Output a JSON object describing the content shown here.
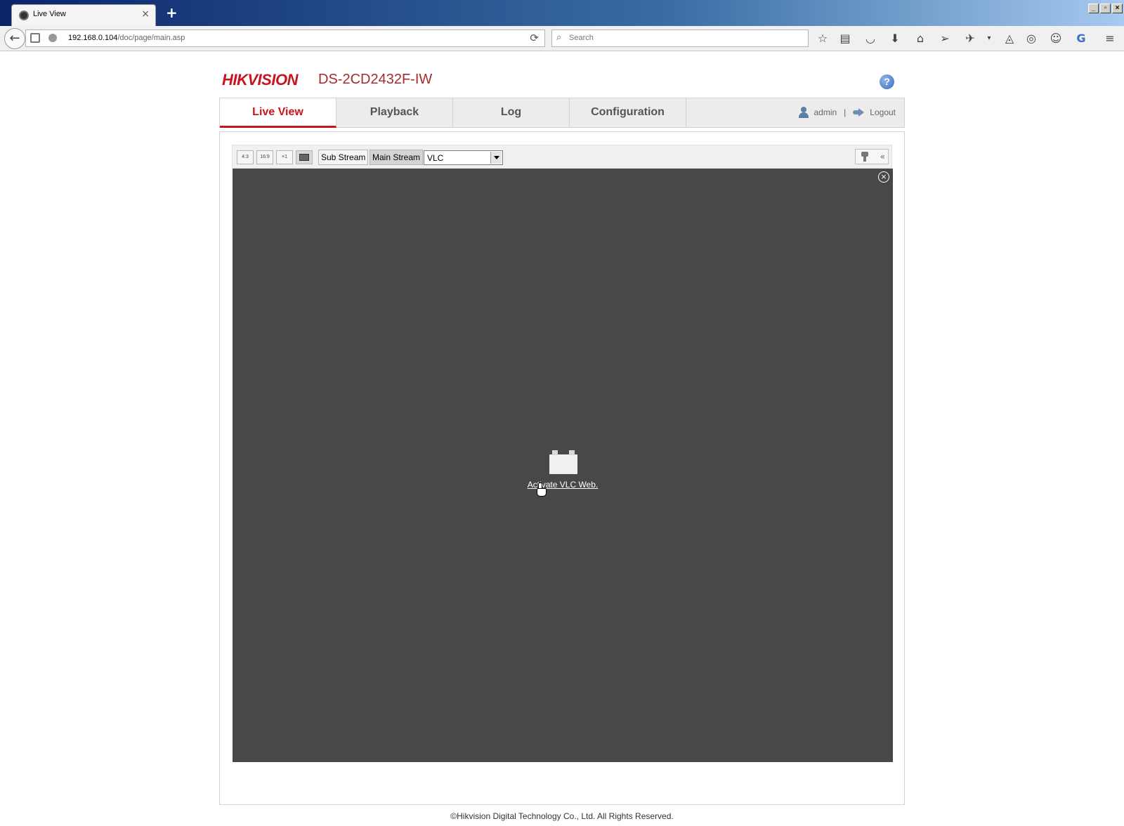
{
  "browser": {
    "tab_title": "Live View",
    "new_tab": "+",
    "tab_close": "×",
    "url_host": "192.168.0.104",
    "url_path": "/doc/page/main.asp",
    "search_placeholder": "Search",
    "window_controls": [
      "_",
      "▫",
      "×"
    ]
  },
  "header": {
    "logo": "HIKVISION",
    "model": "DS-2CD2432F-IW",
    "help": "?"
  },
  "nav": {
    "tabs": [
      {
        "label": "Live View",
        "active": true
      },
      {
        "label": "Playback",
        "active": false
      },
      {
        "label": "Log",
        "active": false
      },
      {
        "label": "Configuration",
        "active": false
      }
    ],
    "user": "admin",
    "separator": "|",
    "logout": "Logout"
  },
  "toolbar": {
    "ratio_buttons": [
      "4:3",
      "16:9",
      "×1",
      ""
    ],
    "sub_stream": "Sub Stream",
    "main_stream": "Main Stream",
    "player_value": "VLC",
    "ptz_toggle": "«"
  },
  "video": {
    "close": "×",
    "activate_link": "Activate VLC Web."
  },
  "footer": {
    "copyright": "©Hikvision Digital Technology Co., Ltd. All Rights Reserved."
  }
}
